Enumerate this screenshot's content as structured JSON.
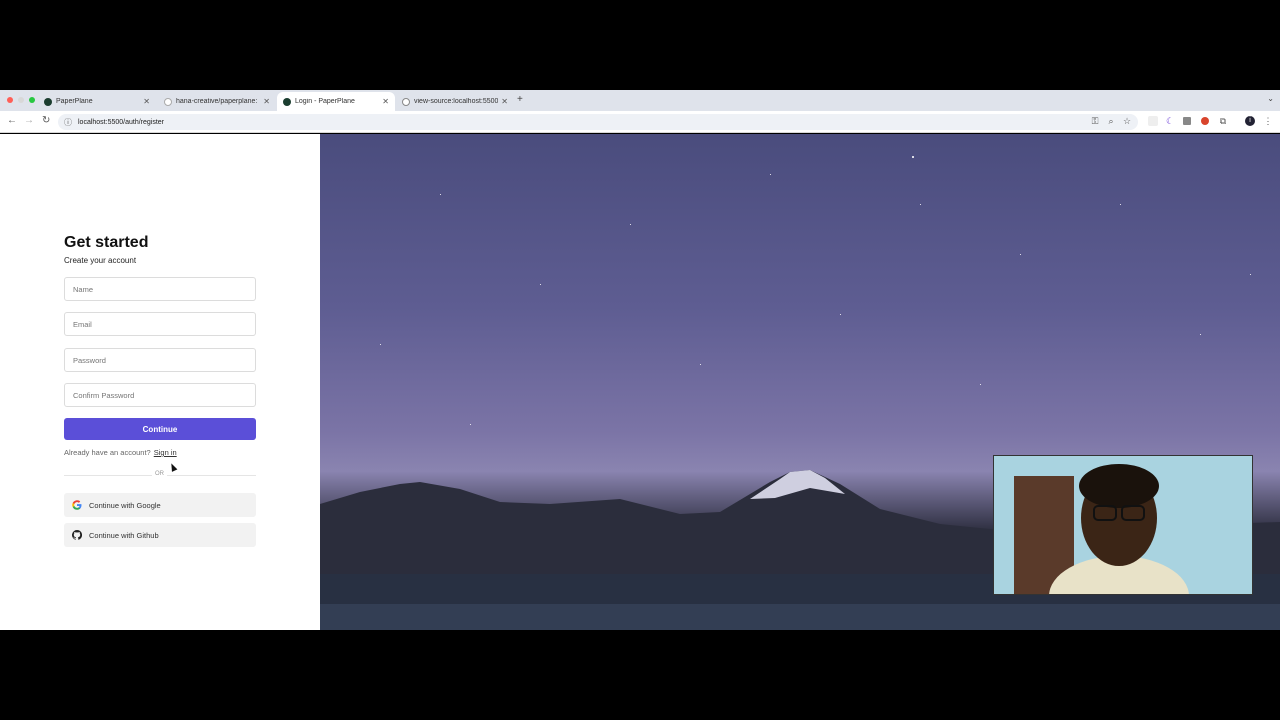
{
  "browser": {
    "tabs": [
      {
        "title": "PaperPlane",
        "active": false
      },
      {
        "title": "hana-creative/paperplane:",
        "active": false
      },
      {
        "title": "Login - PaperPlane",
        "active": true
      },
      {
        "title": "view-source:localhost:5500/",
        "active": false
      }
    ],
    "new_tab": "+",
    "tab_menu": "⌄",
    "url": "localhost:5500/auth/register"
  },
  "form": {
    "title": "Get started",
    "subtitle": "Create your account",
    "fields": {
      "name_placeholder": "Name",
      "email_placeholder": "Email",
      "password_placeholder": "Password",
      "confirm_placeholder": "Confirm Password"
    },
    "continue_label": "Continue",
    "already_text": "Already have an account?",
    "signin_label": "Sign in",
    "or_label": "OR",
    "google_label": "Continue with Google",
    "github_label": "Continue with Github"
  },
  "colors": {
    "accent": "#5b4fd8"
  }
}
